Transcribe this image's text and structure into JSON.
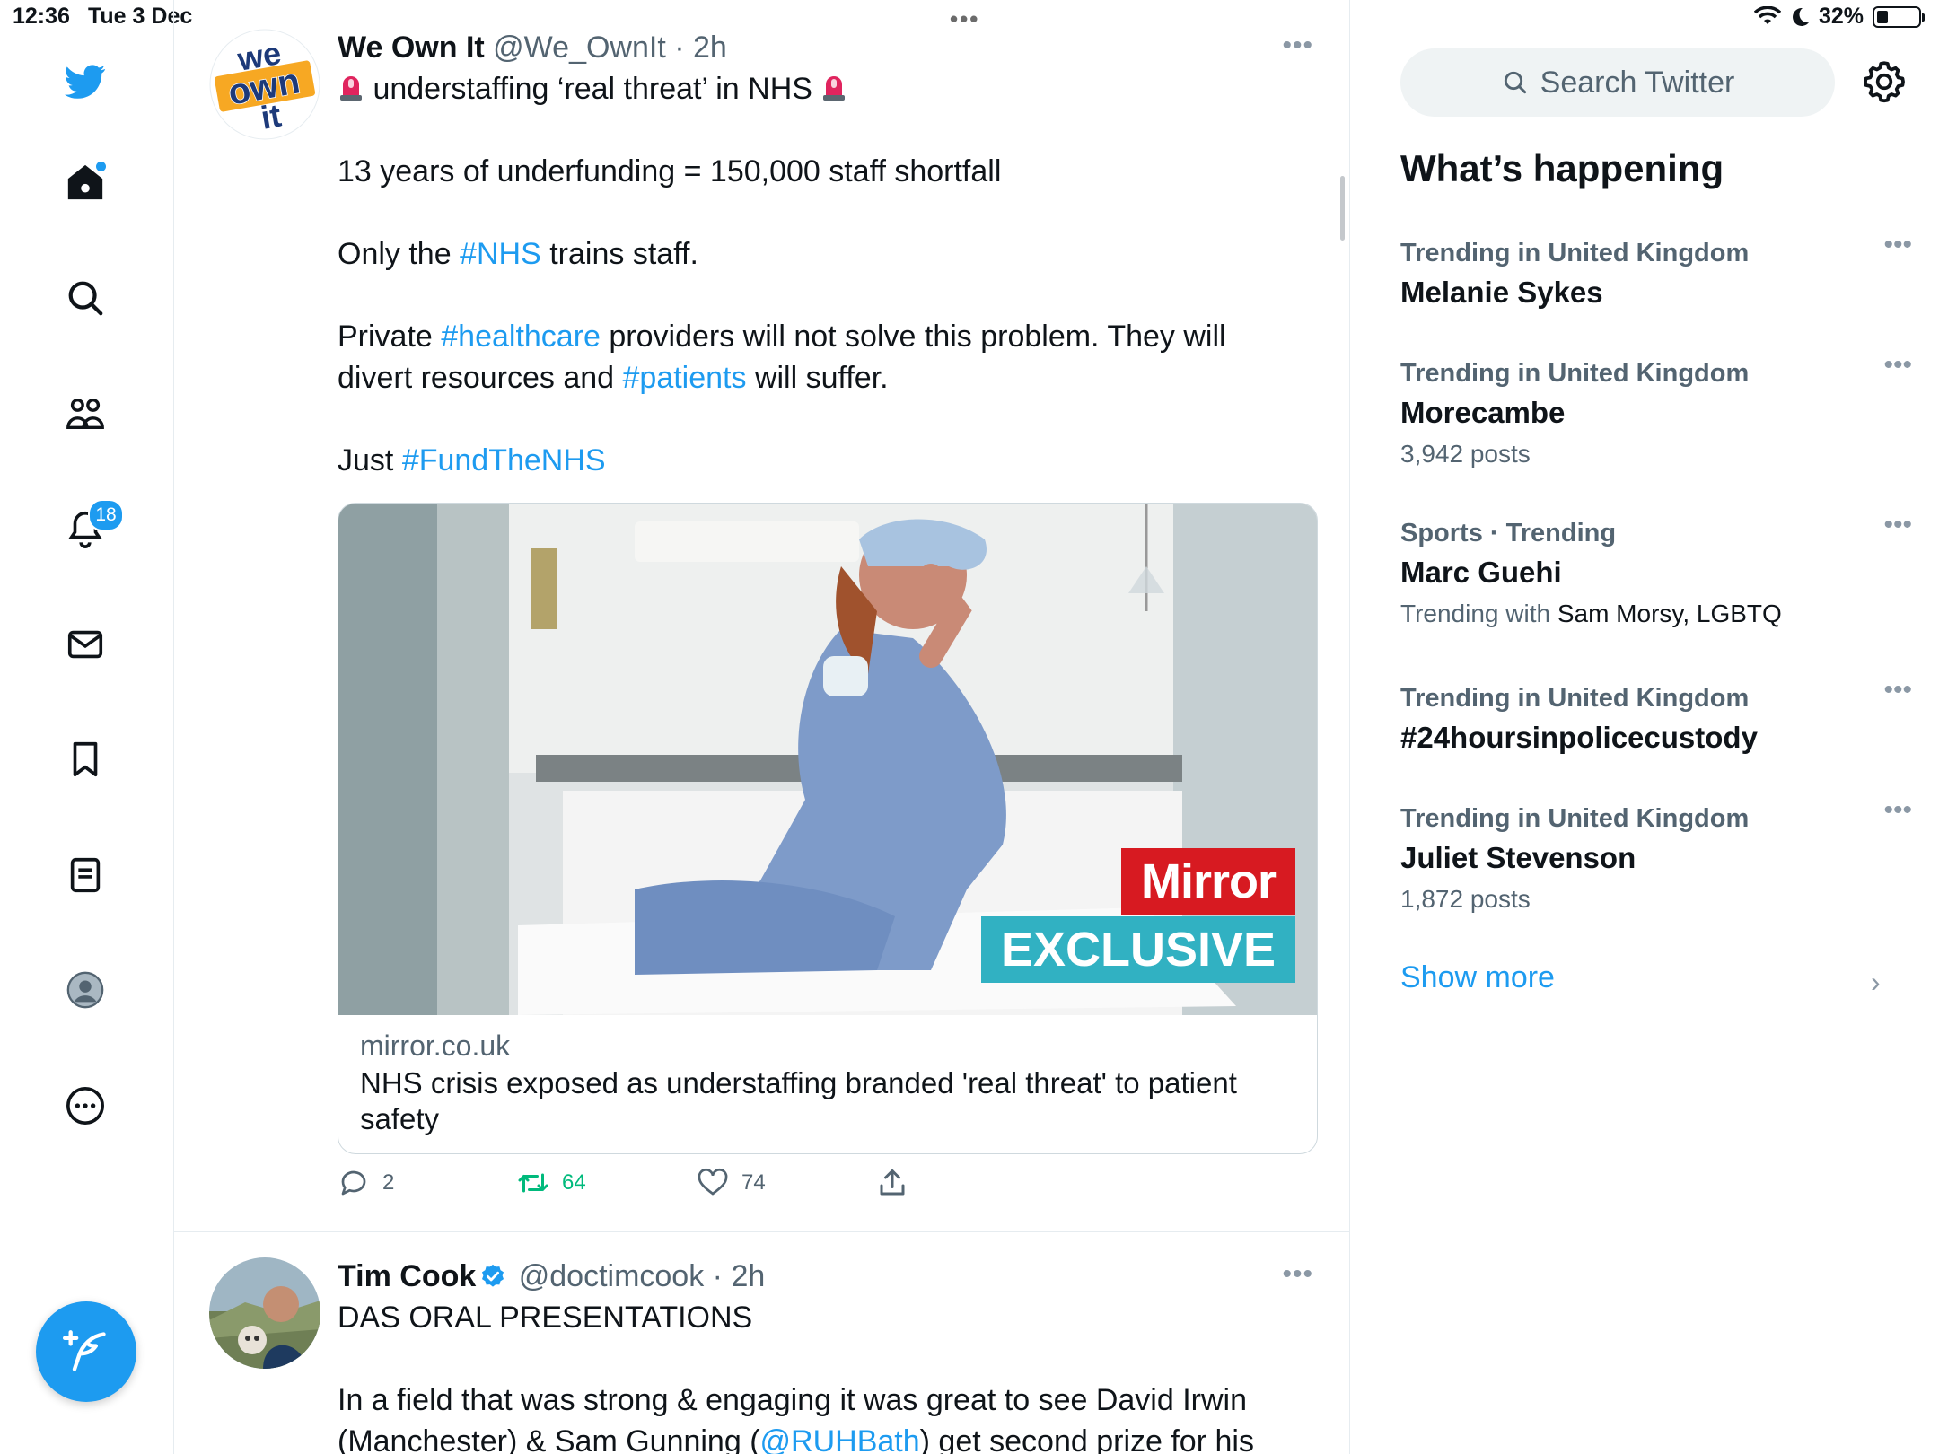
{
  "status_bar": {
    "time": "12:36",
    "date": "Tue 3 Dec",
    "battery": "32%",
    "battery_level": 0.32
  },
  "nav": {
    "notifications_badge": "18",
    "accent_color": "#1d9bf0",
    "icons": [
      "twitter-logo-icon",
      "home-icon",
      "search-icon",
      "communities-icon",
      "notifications-icon",
      "messages-icon",
      "bookmarks-icon",
      "lists-icon",
      "profile-icon",
      "more-icon",
      "compose-icon"
    ]
  },
  "timeline": {
    "tweets": [
      {
        "name": "We Own It",
        "handle": "@We_OwnIt",
        "time": "2h",
        "lines": {
          "l1": "understaffing ‘real threat’ in NHS",
          "l2": "13 years of underfunding = 150,000 staff shortfall",
          "l3a": "Only the ",
          "l3b": "#NHS",
          "l3c": " trains staff.",
          "l4a": "Private ",
          "l4b": "#healthcare",
          "l4c": " providers will not solve this problem. They will",
          "l5a": "divert resources and ",
          "l5b": "#patients",
          "l5c": " will suffer.",
          "l6a": "Just ",
          "l6b": "#FundTheNHS"
        },
        "card": {
          "badge_top": "Mirror",
          "badge_bottom": "EXCLUSIVE",
          "domain": "mirror.co.uk",
          "title": "NHS crisis exposed as understaffing branded 'real threat' to patient safety"
        },
        "actions": {
          "replies": "2",
          "retweets": "64",
          "likes": "74"
        },
        "avatar_text": {
          "line1": "we",
          "line2": "own",
          "line3": "it"
        }
      },
      {
        "name": "Tim Cook",
        "handle": "@doctimcook",
        "time": "2h",
        "lines": {
          "l1": "DAS ORAL PRESENTATIONS",
          "l2": "In a field that was strong & engaging it was great to see David Irwin",
          "l3a": "(Manchester) & Sam Gunning (",
          "l3b": "@RUHBath",
          "l3c": ") get second prize for his"
        }
      }
    ]
  },
  "sidebar": {
    "search_placeholder": "Search Twitter",
    "title": "What’s happening",
    "trends": [
      {
        "context": "Trending in United Kingdom",
        "name": "Melanie Sykes",
        "count": ""
      },
      {
        "context": "Trending in United Kingdom",
        "name": "Morecambe",
        "count": "3,942 posts"
      },
      {
        "context": "Sports · Trending",
        "name": "Marc Guehi",
        "with_label": "Trending with",
        "with_names": "Sam Morsy, LGBTQ"
      },
      {
        "context": "Trending in United Kingdom",
        "name": "#24hoursinpolicecustody",
        "count": ""
      },
      {
        "context": "Trending in United Kingdom",
        "name": "Juliet Stevenson",
        "count": "1,872 posts"
      }
    ],
    "show_more": "Show more"
  }
}
